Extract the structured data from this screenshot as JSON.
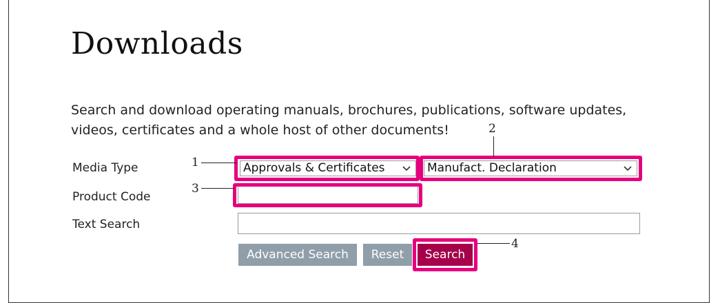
{
  "page": {
    "title": "Downloads",
    "intro_line1": "Search and download operating manuals, brochures, publications, software updates,",
    "intro_line2": "videos, certificates and a whole host of other documents!"
  },
  "form": {
    "media_type_label": "Media Type",
    "media_type_value": "Approvals & Certificates",
    "document_type_value": "Manufact. Declaration",
    "product_code_label": "Product Code",
    "product_code_value": "",
    "text_search_label": "Text Search",
    "text_search_value": ""
  },
  "buttons": {
    "advanced_search": "Advanced Search",
    "reset": "Reset",
    "search": "Search"
  },
  "callouts": [
    "1",
    "2",
    "3",
    "4"
  ],
  "colors": {
    "highlight": "#e6007e",
    "search_button": "#a6004b",
    "secondary_button": "#8f9ea9"
  },
  "icons": {
    "dropdown": "chevron-down-icon"
  }
}
